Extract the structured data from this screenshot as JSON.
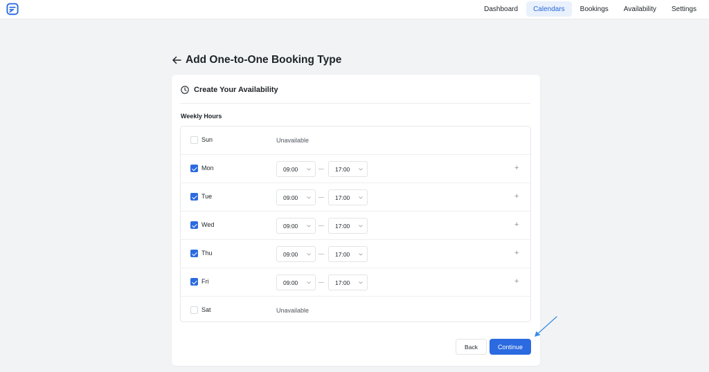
{
  "topbar": {
    "logo_icon": "app-logo-icon",
    "nav": [
      {
        "label": "Dashboard",
        "active": false
      },
      {
        "label": "Calendars",
        "active": true
      },
      {
        "label": "Bookings",
        "active": false
      },
      {
        "label": "Availability",
        "active": false
      },
      {
        "label": "Settings",
        "active": false
      }
    ],
    "accent_color": "#2b6ae0"
  },
  "page": {
    "title": "Add One-to-One Booking Type",
    "back_icon": "arrow-left-icon"
  },
  "card": {
    "title": "Create Your Availability",
    "title_icon": "clock-icon",
    "section_label": "Weekly Hours",
    "days": [
      {
        "day": "Sun",
        "enabled": false,
        "status": "Unavailable"
      },
      {
        "day": "Mon",
        "enabled": true,
        "from": "09:00",
        "to": "17:00"
      },
      {
        "day": "Tue",
        "enabled": true,
        "from": "09:00",
        "to": "17:00"
      },
      {
        "day": "Wed",
        "enabled": true,
        "from": "09:00",
        "to": "17:00"
      },
      {
        "day": "Thu",
        "enabled": true,
        "from": "09:00",
        "to": "17:00"
      },
      {
        "day": "Fri",
        "enabled": true,
        "from": "09:00",
        "to": "17:00"
      },
      {
        "day": "Sat",
        "enabled": false,
        "status": "Unavailable"
      }
    ],
    "add_icon": "+",
    "back_button": "Back",
    "continue_button": "Continue"
  }
}
